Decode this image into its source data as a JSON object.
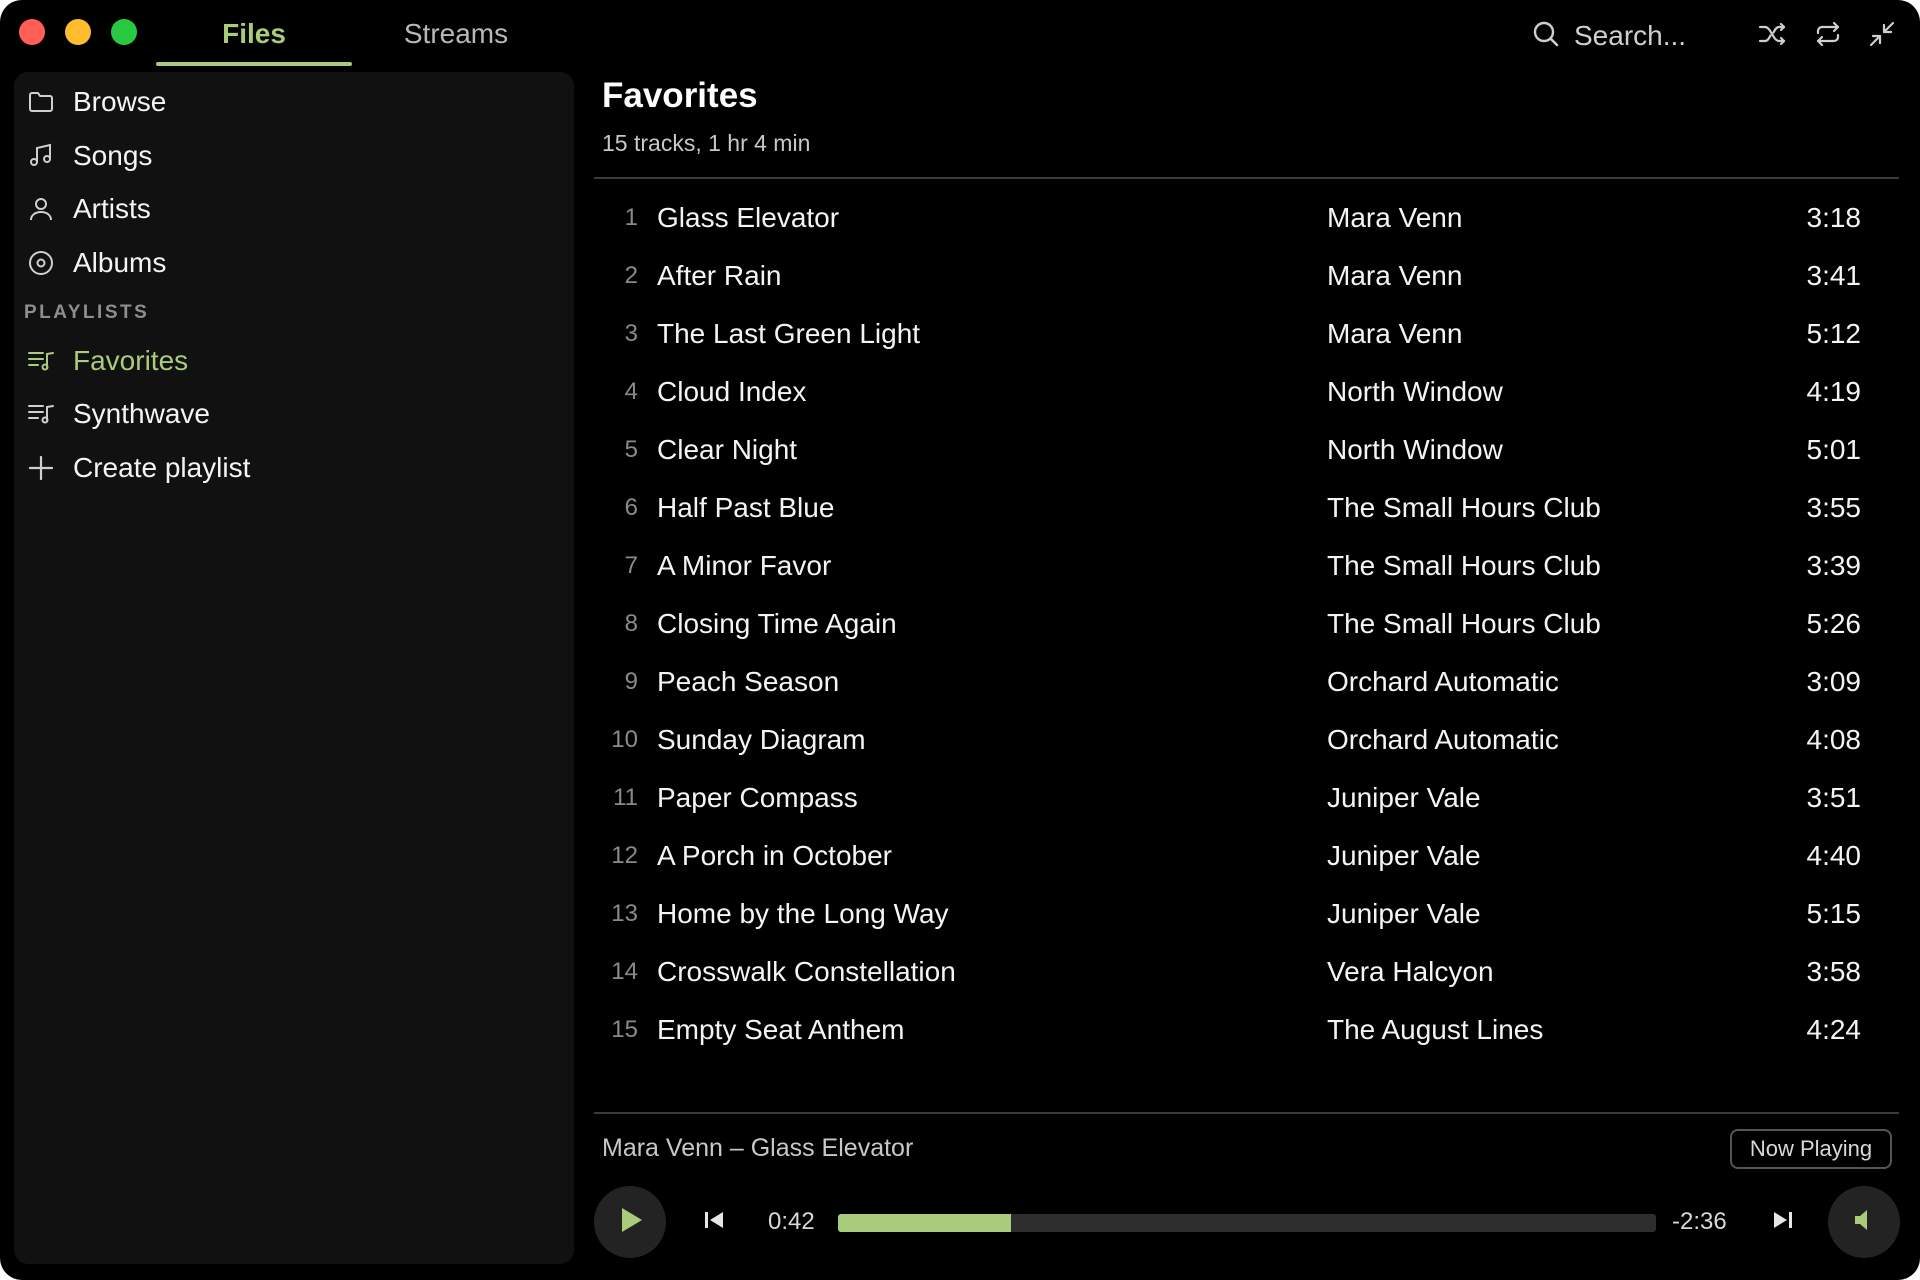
{
  "titlebar": {
    "tabs": [
      {
        "label": "Files",
        "active": true
      },
      {
        "label": "Streams",
        "active": false
      }
    ],
    "search_placeholder": "Search...",
    "icons": [
      "search-icon",
      "shuffle-icon",
      "repeat-icon",
      "collapse-icon"
    ]
  },
  "sidebar": {
    "library": [
      {
        "label": "Browse",
        "icon": "folder-icon"
      },
      {
        "label": "Songs",
        "icon": "music-note-icon"
      },
      {
        "label": "Artists",
        "icon": "person-icon"
      },
      {
        "label": "Albums",
        "icon": "disc-icon"
      }
    ],
    "playlists_label": "PLAYLISTS",
    "playlists": [
      {
        "label": "Favorites",
        "icon": "playlist-icon",
        "active": true
      },
      {
        "label": "Synthwave",
        "icon": "playlist-icon",
        "active": false
      },
      {
        "label": "Create playlist",
        "icon": "plus-icon",
        "active": false
      }
    ]
  },
  "main": {
    "title": "Favorites",
    "subtitle": "15 tracks, 1 hr 4 min",
    "tracks": [
      {
        "num": "1",
        "title": "Glass Elevator",
        "artist": "Mara Venn",
        "duration": "3:18"
      },
      {
        "num": "2",
        "title": "After Rain",
        "artist": "Mara Venn",
        "duration": "3:41"
      },
      {
        "num": "3",
        "title": "The Last Green Light",
        "artist": "Mara Venn",
        "duration": "5:12"
      },
      {
        "num": "4",
        "title": "Cloud Index",
        "artist": "North Window",
        "duration": "4:19"
      },
      {
        "num": "5",
        "title": "Clear Night",
        "artist": "North Window",
        "duration": "5:01"
      },
      {
        "num": "6",
        "title": "Half Past Blue",
        "artist": "The Small Hours Club",
        "duration": "3:55"
      },
      {
        "num": "7",
        "title": "A Minor Favor",
        "artist": "The Small Hours Club",
        "duration": "3:39"
      },
      {
        "num": "8",
        "title": "Closing Time Again",
        "artist": "The Small Hours Club",
        "duration": "5:26"
      },
      {
        "num": "9",
        "title": "Peach Season",
        "artist": "Orchard Automatic",
        "duration": "3:09"
      },
      {
        "num": "10",
        "title": "Sunday Diagram",
        "artist": "Orchard Automatic",
        "duration": "4:08"
      },
      {
        "num": "11",
        "title": "Paper Compass",
        "artist": "Juniper Vale",
        "duration": "3:51"
      },
      {
        "num": "12",
        "title": "A Porch in October",
        "artist": "Juniper Vale",
        "duration": "4:40"
      },
      {
        "num": "13",
        "title": "Home by the Long Way",
        "artist": "Juniper Vale",
        "duration": "5:15"
      },
      {
        "num": "14",
        "title": "Crosswalk Constellation",
        "artist": "Vera Halcyon",
        "duration": "3:58"
      },
      {
        "num": "15",
        "title": "Empty Seat Anthem",
        "artist": "The August Lines",
        "duration": "4:24"
      }
    ]
  },
  "player": {
    "now_playing_text": "Mara Venn – Glass Elevator",
    "now_playing_button": "Now Playing",
    "elapsed": "0:42",
    "remaining": "-2:36",
    "progress_fraction": 0.212
  },
  "colors": {
    "accent": "#a8cc7c",
    "background": "#000000",
    "sidebar": "#111111"
  }
}
